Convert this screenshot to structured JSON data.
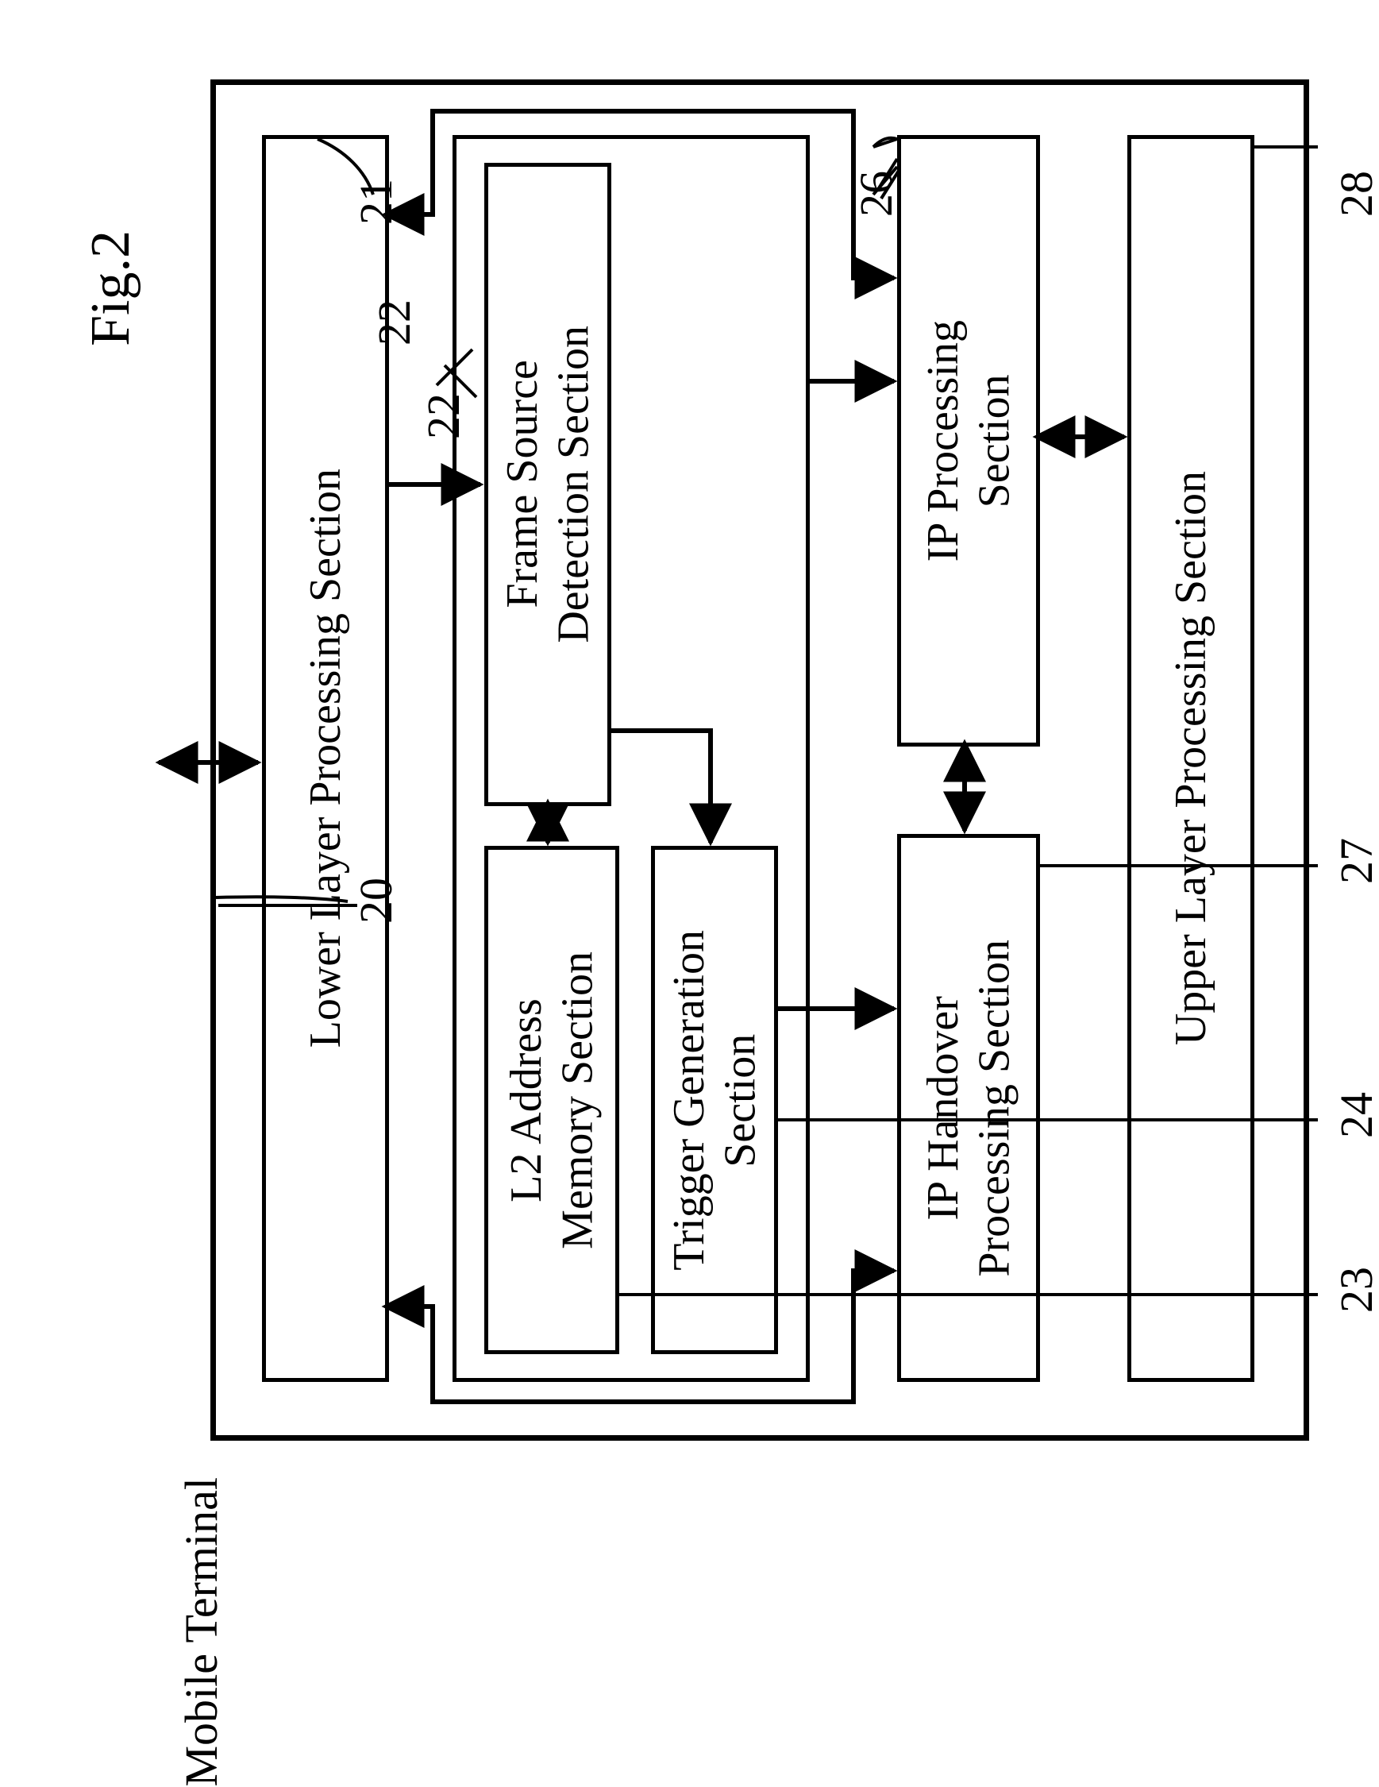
{
  "figure_label": "Fig.2",
  "device_label": "Mobile Terminal",
  "blocks": {
    "upper": {
      "label": "Upper Layer Processing Section",
      "num": "28"
    },
    "ipproc": {
      "label": "IP Processing\nSection",
      "num": "26"
    },
    "ipho": {
      "label": "IP Handover\nProcessing Section",
      "num": "27"
    },
    "fsd": {
      "label": "Frame Source\nDetection Section",
      "num": "22"
    },
    "trig": {
      "label": "Trigger Generation\nSection",
      "num": "24"
    },
    "l2a": {
      "label": "L2 Address\nMemory Section",
      "num": "23"
    },
    "lower": {
      "label": "Lower Layer Processing Section",
      "num": "21"
    },
    "device": {
      "num": "20"
    }
  }
}
